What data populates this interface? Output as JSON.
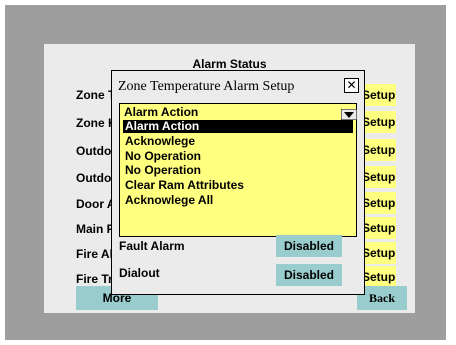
{
  "status": {
    "title": "Alarm Status",
    "rows": [
      {
        "label": "Zone Temperature",
        "setup": "Setup"
      },
      {
        "label": "Zone Humidity",
        "setup": "Setup"
      },
      {
        "label": "Outdoor Temperature",
        "setup": "Setup"
      },
      {
        "label": "Outdoor Humidity",
        "setup": "Setup"
      },
      {
        "label": "Door Alarm",
        "setup": "Setup"
      },
      {
        "label": "Main Power",
        "setup": "Setup"
      },
      {
        "label": "Fire Alarm",
        "setup": "Setup"
      },
      {
        "label": "Fire Trouble",
        "setup": "Setup"
      }
    ],
    "more_label": "More",
    "back_label": "Back"
  },
  "dialog": {
    "title": "Zone Temperature Alarm Setup",
    "close_glyph": "✕",
    "dropdown_value": "Alarm Action",
    "options": [
      {
        "label": "Alarm Action",
        "selected": true
      },
      {
        "label": "Acknowlege",
        "selected": false
      },
      {
        "label": "No Operation",
        "selected": false
      },
      {
        "label": "No Operation",
        "selected": false
      },
      {
        "label": "Clear Ram Attributes",
        "selected": false
      },
      {
        "label": "Acknowlege All",
        "selected": false
      }
    ],
    "fault_alarm_label": "Fault Alarm",
    "fault_alarm_value": "Disabled",
    "dialout_label": "Dialout",
    "dialout_value": "Disabled"
  },
  "colors": {
    "frame": "#9e9e9e",
    "panel": "#ebebeb",
    "yellow": "#ffff80",
    "teal": "#99cccc"
  }
}
